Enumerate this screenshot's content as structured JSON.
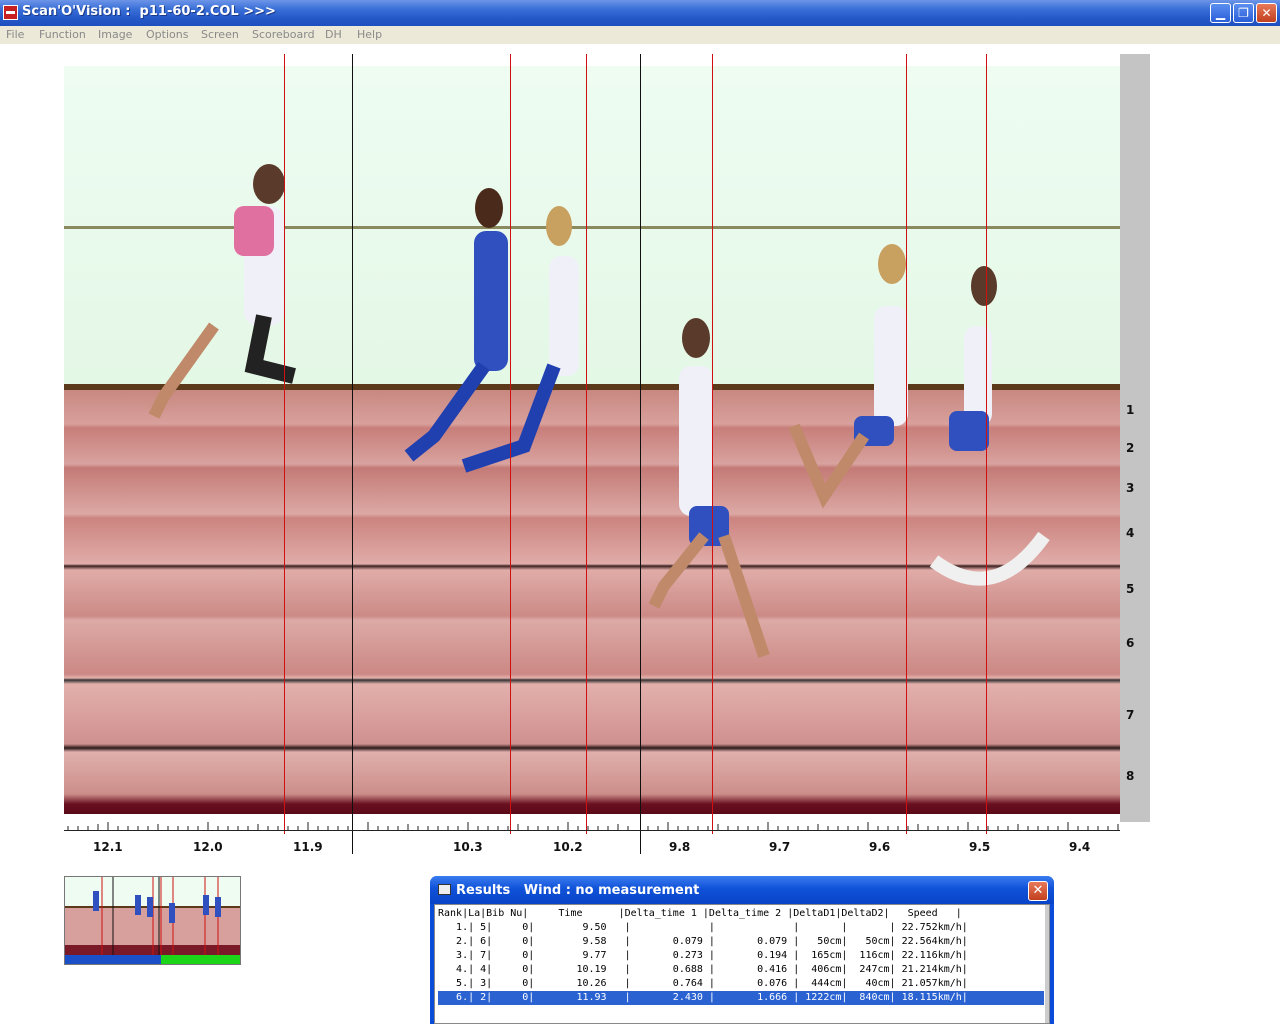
{
  "window": {
    "title": "Scan'O'Vision :  p11-60-2.COL >>>",
    "min_glyph": "▁",
    "max_glyph": "❐",
    "close_glyph": "✕"
  },
  "menu": [
    "File",
    "Function",
    "Image",
    "Options",
    "Screen",
    "Scoreboard",
    "DH",
    "Help"
  ],
  "lanes": [
    "1",
    "2",
    "3",
    "4",
    "5",
    "6",
    "7",
    "8"
  ],
  "time_axis": [
    "12.1",
    "12.0",
    "11.9",
    "10.3",
    "10.2",
    "9.8",
    "9.7",
    "9.6",
    "9.5",
    "9.4"
  ],
  "colors": {
    "marker_line": "#d01010",
    "track": "#d89a98",
    "sky": "#eefcf2",
    "selection": "#2a62d2"
  },
  "results": {
    "title": "Results   Wind : no measurement",
    "close_glyph": "✕",
    "header": "Rank|La|Bib Nu|     Time      |Delta_time 1 |Delta_time 2 |DeltaD1|DeltaD2|   Speed   |",
    "rows": [
      "   1.| 5|     0|        9.50   |             |             |       |       | 22.752km/h|",
      "   2.| 6|     0|        9.58   |       0.079 |       0.079 |   50cm|   50cm| 22.564km/h|",
      "   3.| 7|     0|        9.77   |       0.273 |       0.194 |  165cm|  116cm| 22.116km/h|",
      "   4.| 4|     0|       10.19   |       0.688 |       0.416 |  406cm|  247cm| 21.214km/h|",
      "   5.| 3|     0|       10.26   |       0.764 |       0.076 |  444cm|   40cm| 21.057km/h|",
      "   6.| 2|     0|       11.93   |       2.430 |       1.666 | 1222cm|  840cm| 18.115km/h|"
    ],
    "selected_row": 5
  }
}
